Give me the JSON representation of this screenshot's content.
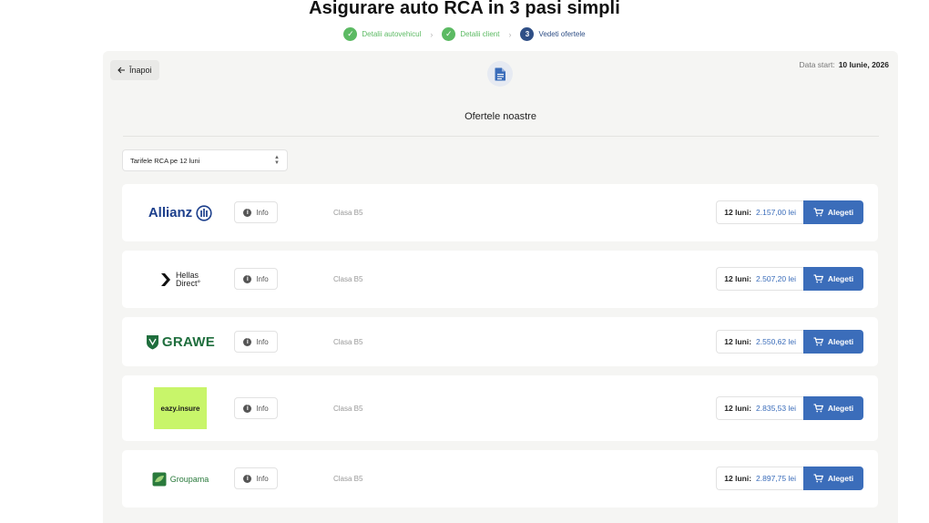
{
  "page": {
    "title": "Asigurare auto RCA in 3 pasi simpli"
  },
  "stepper": {
    "steps": [
      {
        "label": "Detalii autovehicul",
        "state": "done"
      },
      {
        "label": "Detalii client",
        "state": "done"
      },
      {
        "label": "Vedeti ofertele",
        "state": "active",
        "number": "3"
      }
    ],
    "check_glyph": "✓",
    "separator_glyph": "›"
  },
  "panel": {
    "back_label": "Înapoi",
    "start_date_label": "Data start:",
    "start_date_value": "10 Iunie, 2026",
    "section_title": "Ofertele noastre",
    "tariff_select": {
      "value": "Tarifele RCA pe 12 luni"
    }
  },
  "offers": [
    {
      "insurer": "Allianz",
      "logo_text": "Allianz",
      "info_label": "Info",
      "class_label": "Clasa B5",
      "period_label": "12 luni:",
      "price": "2.157,00 lei",
      "choose_label": "Alegeti"
    },
    {
      "insurer": "Hellas Direct",
      "logo_text_1": "Hellas",
      "logo_text_2": "Direct",
      "info_label": "Info",
      "class_label": "Clasa B5",
      "period_label": "12 luni:",
      "price": "2.507,20 lei",
      "choose_label": "Alegeti"
    },
    {
      "insurer": "Grawe",
      "logo_text": "GRAWE",
      "info_label": "Info",
      "class_label": "Clasa B5",
      "period_label": "12 luni:",
      "price": "2.550,62 lei",
      "choose_label": "Alegeti"
    },
    {
      "insurer": "eazy.insure",
      "logo_text": "eazy.insure",
      "info_label": "Info",
      "class_label": "Clasa B5",
      "period_label": "12 luni:",
      "price": "2.835,53 lei",
      "choose_label": "Alegeti"
    },
    {
      "insurer": "Groupama",
      "logo_text": "Groupama",
      "info_label": "Info",
      "class_label": "Clasa B5",
      "period_label": "12 luni:",
      "price": "2.897,75 lei",
      "choose_label": "Alegeti"
    }
  ],
  "colors": {
    "accent": "#3b6dba",
    "step_done": "#5cba63",
    "step_active": "#2f4f86",
    "panel_bg": "#f5f5f3"
  },
  "icons": {
    "back": "arrow-left-icon",
    "document": "document-icon",
    "info": "info-icon",
    "cart": "cart-icon",
    "select": "chevron-up-down-icon"
  }
}
